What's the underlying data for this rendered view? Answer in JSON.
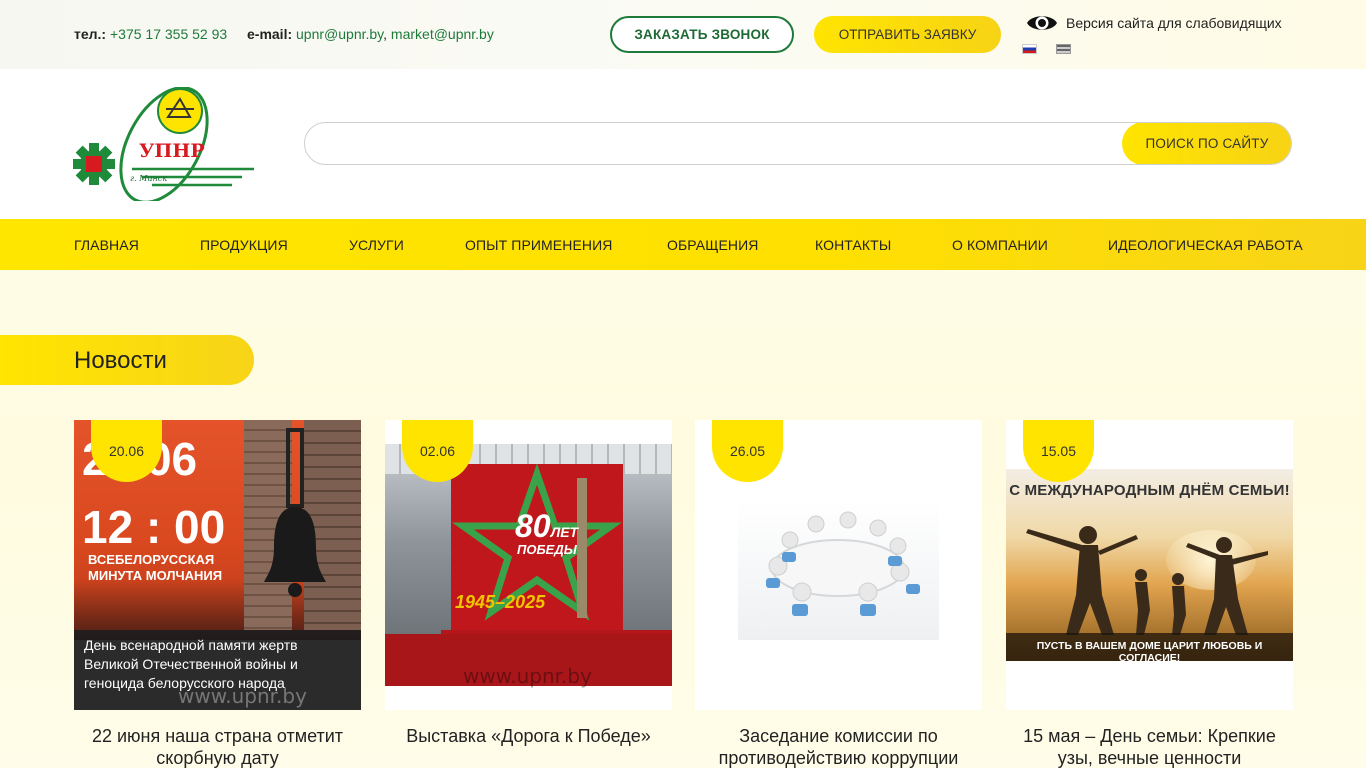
{
  "topbar": {
    "phone_label": "тел.:",
    "phone": "+375 17 355 52 93",
    "email_label": "e-mail:",
    "email1": "upnr@upnr.by",
    "email_sep": ",",
    "email2": "market@upnr.by",
    "call_button": "ЗАКАЗАТЬ ЗВОНОК",
    "request_button": "ОТПРАВИТЬ ЗАЯВКУ",
    "vision_label": "Версия сайта для слабовидящих",
    "languages": [
      "ru-flag-icon",
      "en-flag-icon"
    ]
  },
  "logo": {
    "text": "УПНР",
    "city": "г. Минск",
    "colors": {
      "green": "#1e8a3a",
      "red": "#d71920",
      "yellow": "#ffe400"
    }
  },
  "search": {
    "placeholder": "",
    "value": "",
    "button": "ПОИСК ПО САЙТУ"
  },
  "nav": {
    "items": [
      "ГЛАВНАЯ",
      "ПРОДУКЦИЯ",
      "УСЛУГИ",
      "ОПЫТ ПРИМЕНЕНИЯ",
      "ОБРАЩЕНИЯ",
      "КОНТАКТЫ",
      "О КОМПАНИИ",
      "ИДЕОЛОГИЧЕСКАЯ РАБОТА"
    ]
  },
  "news": {
    "heading": "Новости",
    "cards": [
      {
        "date": "20.06",
        "title": "22 июня наша страна отметит скорбную дату",
        "img": {
          "big": "22.06",
          "time": "12 : 00",
          "line1": "ВСЕБЕЛОРУССКАЯ",
          "line2": "МИНУТА МОЛЧАНИЯ",
          "caption": "День всенародной памяти жертв Великой Отечественной войны и геноцида белорусского народа",
          "watermark": "www.upnr.by"
        }
      },
      {
        "date": "02.06",
        "title": "Выставка «Дорога к Победе»",
        "img": {
          "big": "80",
          "small": "ЛЕТ",
          "line": "ПОБЕДЫ",
          "years": "1945–2025",
          "watermark": "www.upnr.by"
        }
      },
      {
        "date": "26.05",
        "title": "Заседание комиссии по противодействию коррупции",
        "img": {}
      },
      {
        "date": "15.05",
        "title": "15 мая – День семьи: Крепкие узы, вечные ценности",
        "img": {
          "headline": "С МЕЖДУНАРОДНЫМ ДНЁМ СЕМЬИ!",
          "footer": "ПУСТЬ В ВАШЕМ ДОМЕ ЦАРИТ ЛЮБОВЬ И СОГЛАСИЕ!"
        }
      }
    ]
  },
  "colors": {
    "accent_yellow": "#ffe400",
    "accent_green": "#1e7a3a"
  }
}
